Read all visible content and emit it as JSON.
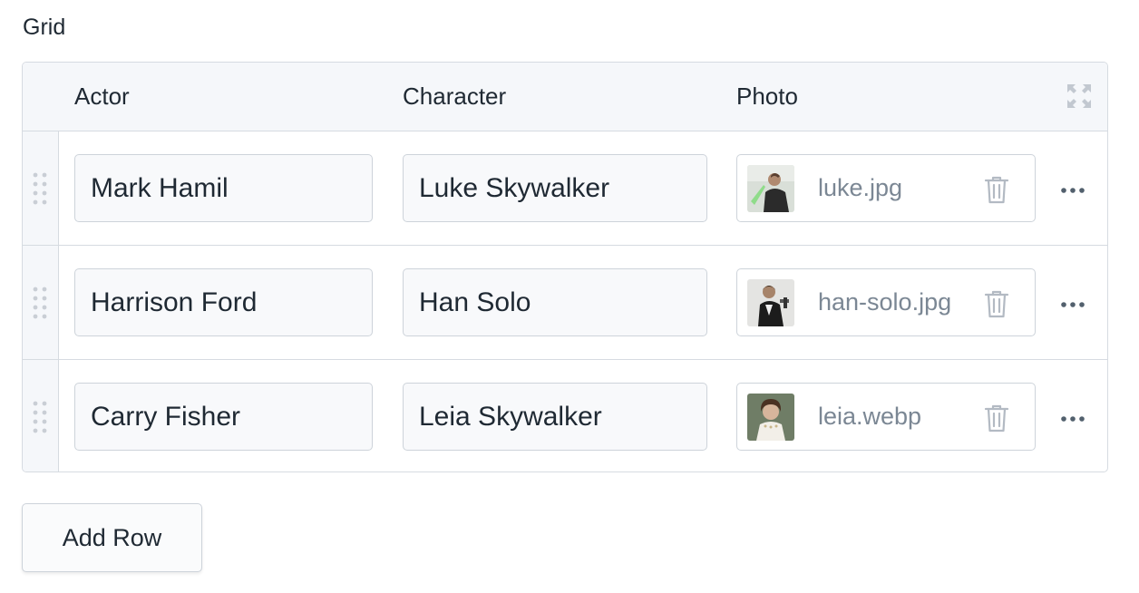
{
  "field": {
    "label": "Grid"
  },
  "grid": {
    "columns": [
      "Actor",
      "Character",
      "Photo"
    ],
    "rows": [
      {
        "actor": "Mark Hamil",
        "character": "Luke Skywalker",
        "photo": "luke.jpg"
      },
      {
        "actor": "Harrison Ford",
        "character": "Han Solo",
        "photo": "han-solo.jpg"
      },
      {
        "actor": "Carry Fisher",
        "character": "Leia Skywalker",
        "photo": "leia.webp"
      }
    ]
  },
  "actions": {
    "add_row": "Add Row"
  },
  "icons": {
    "expand": "expand-icon",
    "drag": "drag-handle-icon",
    "trash": "trash-icon",
    "more": "more-horizontal-icon"
  },
  "colors": {
    "border": "#d6dbe1",
    "header_bg": "#f5f7fa",
    "text": "#1f2933",
    "muted": "#7b8794"
  }
}
